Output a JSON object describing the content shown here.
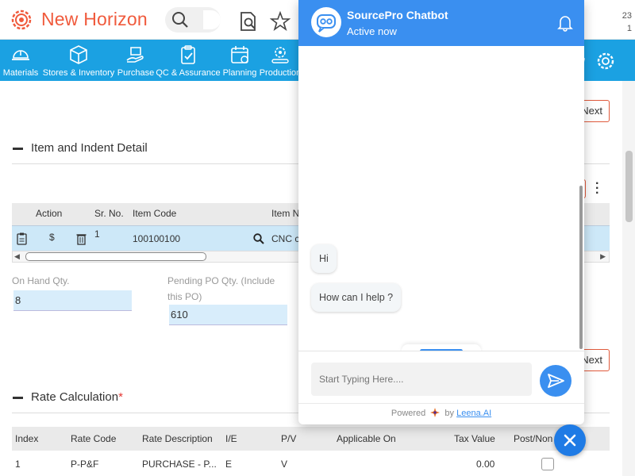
{
  "app": {
    "brand": "New Horizon",
    "top_right_text_line1": "23",
    "top_right_text_line2": "1"
  },
  "nav": {
    "items": [
      {
        "label": "Materials",
        "icon": "hard-hat-icon"
      },
      {
        "label": "Stores & Inventory",
        "icon": "box-icon"
      },
      {
        "label": "Purchase",
        "icon": "cart-hand-icon"
      },
      {
        "label": "QC & Assurance",
        "icon": "clipboard-check-icon"
      },
      {
        "label": "Planning",
        "icon": "calendar-icon"
      },
      {
        "label": "Production",
        "icon": "gear-conveyor-icon"
      }
    ]
  },
  "main": {
    "next_label": "Next",
    "section_item_indent": "Item and Indent Detail",
    "grid": {
      "headers": {
        "action": "Action",
        "sr_no": "Sr. No.",
        "item_code": "Item Code",
        "item_name": "Item N"
      },
      "row": {
        "sr_no": "1",
        "action_dollar": "$",
        "item_code": "100100100",
        "item_name": "CNC c"
      }
    },
    "fields": {
      "on_hand_label": "On Hand Qty.",
      "on_hand_value": "8",
      "pending_po_label_1": "Pending PO Qty. (Include",
      "pending_po_label_2": "this PO)",
      "pending_po_value": "610"
    },
    "rate_section": {
      "title": "Rate Calculation",
      "required_mark": "*",
      "headers": {
        "index": "Index",
        "rate_code": "Rate Code",
        "rate_desc": "Rate Description",
        "ie": "I/E",
        "pv": "P/V",
        "applicable_on": "Applicable On",
        "tax_value": "Tax Value",
        "post": "Post/Non"
      },
      "rows": [
        {
          "index": "1",
          "rate_code": "P-P&F",
          "rate_desc": "PURCHASE - P...",
          "ie": "E",
          "pv": "V",
          "tax_value": "0.00"
        }
      ]
    }
  },
  "chat": {
    "title": "SourcePro Chatbot",
    "status": "Active now",
    "messages": [
      "Hi",
      "How can I help ?"
    ],
    "input_placeholder": "Start Typing Here....",
    "powered_prefix": "Powered",
    "powered_by": "by",
    "powered_brand": "Leena.AI"
  },
  "colors": {
    "brand": "#f05a3c",
    "nav_bg": "#1ba1e2",
    "chat_accent": "#3a8ff0"
  }
}
